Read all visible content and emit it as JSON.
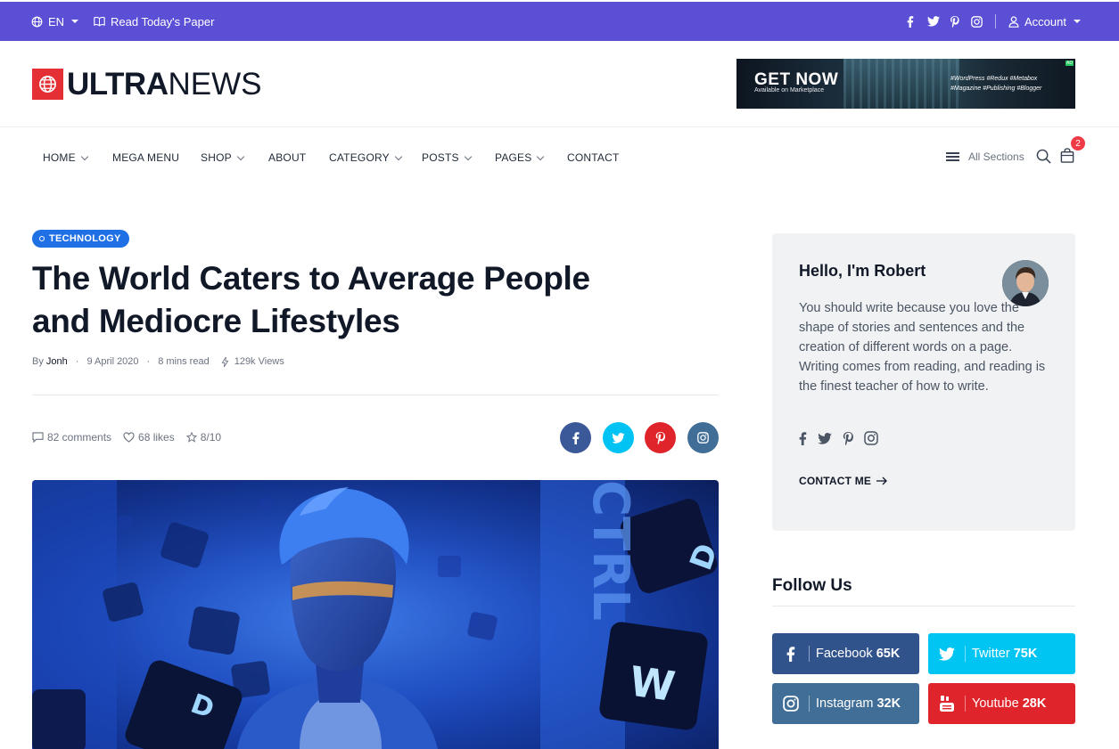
{
  "topbar": {
    "language": "EN",
    "read_paper": "Read Today's Paper",
    "account": "Account",
    "social_icons": [
      "facebook-icon",
      "twitter-icon",
      "pinterest-icon",
      "instagram-icon"
    ],
    "bg_color": "#5b4fd6"
  },
  "logo": {
    "ultra": "ULTRA",
    "news": "NEWS",
    "accent": "#e42f35"
  },
  "ad": {
    "headline": "GET NOW",
    "sub": "Available on Marketplace",
    "tags": "#WordPress  #Redux  #Metabox  #Magazine  #Publishing  #Blogger",
    "badge": "AD"
  },
  "nav": {
    "items": [
      {
        "label": "HOME"
      },
      {
        "label": "MEGA MENU"
      },
      {
        "label": "SHOP"
      },
      {
        "label": "ABOUT"
      },
      {
        "label": "CATEGORY"
      },
      {
        "label": "POSTS"
      },
      {
        "label": "PAGES"
      },
      {
        "label": "CONTACT"
      }
    ],
    "all_sections": "All Sections",
    "cart_count": "2"
  },
  "article": {
    "category": "TECHNOLOGY",
    "title": "The World Caters to Average People and Mediocre Lifestyles",
    "by": "By",
    "author": "Jonh",
    "date": "9 April 2020",
    "read_time": "8 mins read",
    "views": "129k Views",
    "comments": "82 comments",
    "likes": "68 likes",
    "rating": "8/10",
    "share_colors": {
      "facebook": "#3b5998",
      "twitter": "#00c3f3",
      "pinterest": "#e0242b",
      "instagram": "#406e96"
    }
  },
  "sidebar": {
    "about": {
      "title": "Hello, I'm Robert",
      "text": "You should write because you love the shape of stories and sentences and the creation of different words on a page. Writing comes from reading, and reading is the finest teacher of how to write.",
      "contact": "CONTACT ME"
    },
    "follow": {
      "title": "Follow Us",
      "buttons": [
        {
          "label": "Facebook",
          "count": "65K",
          "color": "#31538c"
        },
        {
          "label": "Twitter",
          "count": "75K",
          "color": "#00c5f3"
        },
        {
          "label": "Instagram",
          "count": "32K",
          "color": "#406e96"
        },
        {
          "label": "Youtube",
          "count": "28K",
          "color": "#e0242b"
        }
      ]
    }
  }
}
